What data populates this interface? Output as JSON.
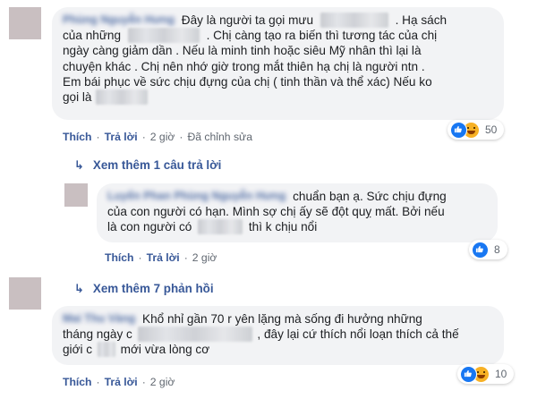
{
  "comments": [
    {
      "lines": [
        "Đây là người ta gọi mưu",
        ". Hạ sách",
        "của những",
        ". Chị càng tạo ra biến thì tương tác của chị",
        "ngày càng giảm dần . Nếu là minh tinh hoặc siêu Mỹ nhân thì lại là",
        "chuyện khác . Chị nên nhớ giờ trong mắt thiên hạ chị là người ntn .",
        "Em bái phục về sức chịu đựng của chị ( tinh thần và thể xác) Nếu ko",
        "gọi là"
      ],
      "author_blurred": "Phùng Nguyễn Hưng",
      "reaction_count": "50",
      "actions": {
        "like": "Thích",
        "reply": "Trả lời",
        "time": "2 giờ",
        "edited": "Đã chỉnh sửa"
      }
    },
    {
      "lines": [
        "chuẩn bạn ạ. Sức chịu đựng",
        "của con người có hạn. Mình sợ chị ấy sẽ đột quỵ mất. Bởi nếu",
        "là con người có",
        "thì k chịu nổi"
      ],
      "author_blurred": "Luyến Phan Phùng Nguyễn Hưng",
      "reaction_count": "8",
      "actions": {
        "like": "Thích",
        "reply": "Trả lời",
        "time": "2 giờ"
      }
    },
    {
      "lines": [
        "Khổ nhỉ gần 70 r yên lặng mà sống đi hưởng những",
        "tháng ngày c",
        ", đây lại cứ thích nổi loạn thích cả thế",
        "giới c",
        "mới vừa lòng cơ"
      ],
      "author_blurred": "Mai Thu Vàng",
      "reaction_count": "10",
      "actions": {
        "like": "Thích",
        "reply": "Trả lời",
        "time": "2 giờ"
      }
    }
  ],
  "view_more_replies": "Xem thêm 1 câu trả lời",
  "view_more_feedback": "Xem thêm 7 phản hồi",
  "colors": {
    "link": "#385898",
    "bubble": "#f2f3f5",
    "like_blue": "#1877f2",
    "haha_yellow": "#f7b125"
  },
  "icons": [
    "like-icon",
    "haha-icon",
    "reply-arrow-icon",
    "avatar"
  ]
}
